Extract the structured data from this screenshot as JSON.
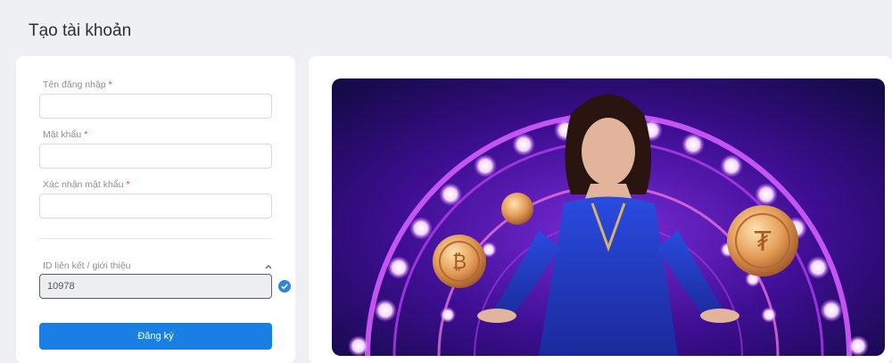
{
  "page": {
    "title": "Tạo tài khoản"
  },
  "form": {
    "username": {
      "label": "Tên đăng nhập",
      "required_mark": "*",
      "value": ""
    },
    "password": {
      "label": "Mật khẩu",
      "required_mark": "*",
      "value": ""
    },
    "confirm_password": {
      "label": "Xác nhận mật khẩu",
      "required_mark": "*",
      "value": ""
    },
    "referral": {
      "label": "ID liên kết / giới thiệu",
      "value": "10978",
      "verified": true
    },
    "submit_label": "Đăng ký"
  },
  "icons": {
    "collapse": "chevron-up-icon",
    "verified": "check-circle-icon"
  },
  "colors": {
    "primary": "#1a7fe3",
    "required": "#e0413c",
    "banner_bg": "#3a0b8a",
    "neon": "#c74dff"
  }
}
